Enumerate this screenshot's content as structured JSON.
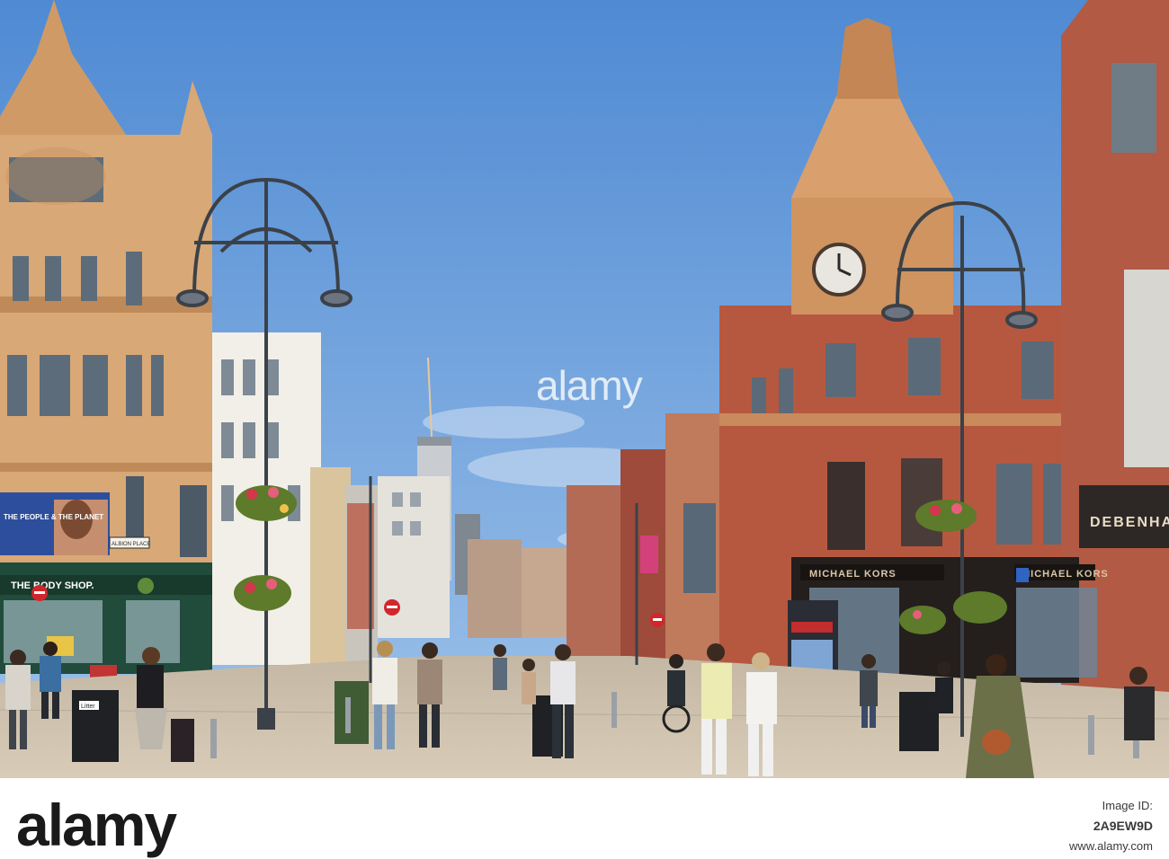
{
  "photo": {
    "signs": {
      "body_shop": "THE BODY SHOP.",
      "store_corner": "DEBENHAMS",
      "fashion_store": "MICHAEL KORS",
      "fashion_store_2": "MICHAEL KORS",
      "poster_text": "THE PEOPLE & THE PLANET",
      "street_name": "ALBION PLACE",
      "bin_label": "Litter"
    }
  },
  "watermark": "alamy",
  "footer": {
    "logo": "alamy",
    "image_id_label": "Image ID:",
    "image_id": "2A9EW9D",
    "site": "www.alamy.com"
  },
  "colors": {
    "sky": "#5b93d6",
    "sandstone": "#d9a878",
    "brick": "#b5553c",
    "pavement": "#cfc2ad"
  }
}
